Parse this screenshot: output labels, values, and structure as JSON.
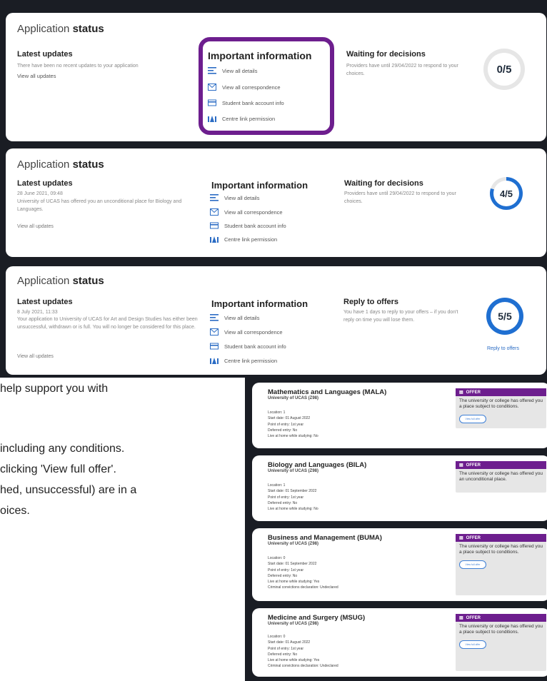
{
  "cards": [
    {
      "app_title": "Application",
      "app_title_bold": "status",
      "latest_header": "Latest updates",
      "latest_date": "",
      "latest_text": "There have been no recent updates to your application",
      "latest_link": "View all updates",
      "important_title": "Important information",
      "important_items": [
        "View all details",
        "View all correspondence",
        "Student bank account info",
        "Centre link permission"
      ],
      "right_header": "Waiting for decisions",
      "right_text": "Providers have until 29/04/2022 to respond to your choices.",
      "ring_value": "0/5",
      "ring_progress": 0,
      "right_link": ""
    },
    {
      "app_title": "Application",
      "app_title_bold": "status",
      "latest_header": "Latest updates",
      "latest_date": "28 June 2021, 09:48",
      "latest_text": "University of UCAS has offered you an unconditional place for Biology and Languages.",
      "latest_link": "View all updates",
      "important_title": "Important information",
      "important_items": [
        "View all details",
        "View all correspondence",
        "Student bank account info",
        "Centre link permission"
      ],
      "right_header": "Waiting for decisions",
      "right_text": "Providers have until 29/04/2022 to respond to your choices.",
      "ring_value": "4/5",
      "ring_progress": 0.8,
      "right_link": ""
    },
    {
      "app_title": "Application",
      "app_title_bold": "status",
      "latest_header": "Latest updates",
      "latest_date": "8 July 2021, 11:33",
      "latest_text": "Your application to University of UCAS for Art and Design Studies has either been unsuccessful, withdrawn or is full. You will no longer be considered for this place.",
      "latest_link": "View all updates",
      "important_title": "Important information",
      "important_items": [
        "View all details",
        "View all correspondence",
        "Student bank account info",
        "Centre link permission"
      ],
      "right_header": "Reply to offers",
      "right_text": "You have 1 days to reply to your offers – if you don't reply on time you will lose them.",
      "ring_value": "5/5",
      "ring_progress": 1,
      "right_link": "Reply to offers"
    }
  ],
  "body_lines": [
    "help support you with",
    "including any conditions.",
    "clicking 'View full offer'.",
    "hed, unsuccessful) are in a",
    "oices."
  ],
  "courses": [
    {
      "title": "Mathematics and Languages (MALA)",
      "provider": "University of UCAS (Z98)",
      "details": [
        "Location: 1",
        "Start date: 01 August 2022",
        "Point of entry: 1st year",
        "Deferred entry: No",
        "Live at home while studying: No"
      ],
      "offer_label": "OFFER",
      "offer_text": "The university or college has offered you a place subject to conditions.",
      "offer_button": "View full offer"
    },
    {
      "title": "Biology and Languages (BILA)",
      "provider": "University of UCAS (Z98)",
      "details": [
        "Location: 1",
        "Start date: 01 September 2022",
        "Point of entry: 1st year",
        "Deferred entry: No",
        "Live at home while studying: No"
      ],
      "offer_label": "OFFER",
      "offer_text": "The university or college has offered you an unconditional place.",
      "offer_button": ""
    },
    {
      "title": "Business and Management (BUMA)",
      "provider": "University of UCAS (Z98)",
      "details": [
        "Location: 0",
        "Start date: 01 September 2022",
        "Point of entry: 1st year",
        "Deferred entry: No",
        "Live at home while studying: Yes",
        "Criminal convictions declaration: Undeclared"
      ],
      "offer_label": "OFFER",
      "offer_text": "The university or college has offered you a place subject to conditions.",
      "offer_button": "View full offer"
    },
    {
      "title": "Medicine and Surgery (MSUG)",
      "provider": "University of UCAS (Z98)",
      "details": [
        "Location: 0",
        "Start date: 01 August 2022",
        "Point of entry: 1st year",
        "Deferred entry: No",
        "Live at home while studying: Yes",
        "Criminal convictions declaration: Undeclared"
      ],
      "offer_label": "OFFER",
      "offer_text": "The university or college has offered you a place subject to conditions.",
      "offer_button": "View full offer"
    }
  ],
  "colors": {
    "panel_bg": "#1a1d24",
    "highlight": "#6d1e8e",
    "ring_blue": "#1f6fd1",
    "ring_grey": "#e6e6e6",
    "offer_purple": "#6d1e8e",
    "icon_blue": "#2b6cc4"
  },
  "icons": [
    "details-icon",
    "correspondence-icon",
    "bank-icon",
    "centre-link-icon",
    "offer-icon"
  ]
}
